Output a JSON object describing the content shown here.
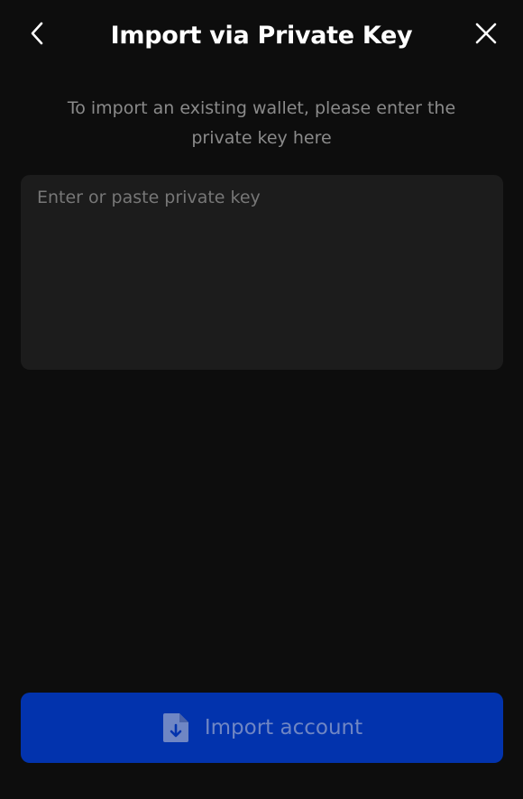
{
  "header": {
    "title": "Import via Private Key",
    "back_icon": "chevron-left-icon",
    "close_icon": "close-icon"
  },
  "description": "To import an existing wallet, please enter the private key here",
  "key_input": {
    "placeholder": "Enter or paste private key",
    "value": ""
  },
  "import_button": {
    "label": "Import account",
    "icon": "file-download-icon",
    "state": "disabled"
  },
  "colors": {
    "background": "#0d0d0d",
    "input_background": "#1c1c1c",
    "button_background": "#0233ad",
    "button_text": "#6f86c4",
    "muted_text": "#8a8a8a"
  }
}
